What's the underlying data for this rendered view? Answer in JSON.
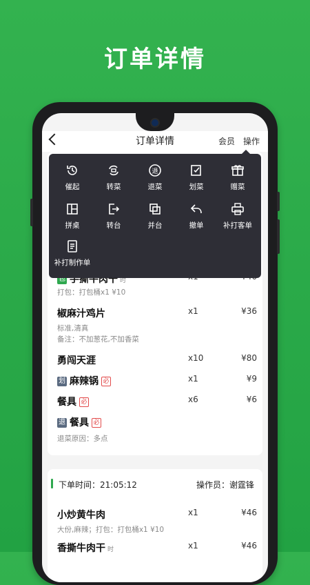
{
  "hero": {
    "title": "订单详情"
  },
  "navbar": {
    "title": "订单详情",
    "member": "会员",
    "ops": "操作"
  },
  "menu": {
    "items": [
      {
        "label": "催起",
        "icon": "clock-rewind-icon"
      },
      {
        "label": "转菜",
        "icon": "transfer-dish-icon"
      },
      {
        "label": "退菜",
        "icon": "return-dish-icon"
      },
      {
        "label": "划菜",
        "icon": "mark-dish-icon"
      },
      {
        "label": "赠菜",
        "icon": "gift-icon"
      },
      {
        "label": "拼桌",
        "icon": "merge-table-icon"
      },
      {
        "label": "转台",
        "icon": "switch-table-icon"
      },
      {
        "label": "并台",
        "icon": "combine-table-icon"
      },
      {
        "label": "撤单",
        "icon": "undo-icon"
      },
      {
        "label": "补打客单",
        "icon": "printer-icon"
      },
      {
        "label": "补打制作单",
        "icon": "document-icon"
      }
    ]
  },
  "order1": {
    "items": [
      {
        "tag": "包",
        "name": "手撕牛肉干",
        "note": "时",
        "qty": "x1",
        "price": "¥46",
        "sub": "打包：打包桶x1 ¥10"
      },
      {
        "name": "椒麻汁鸡片",
        "qty": "x1",
        "price": "¥36",
        "sub": "标准,清真",
        "sub2": "备注：不加葱花,不加香菜"
      },
      {
        "name": "勇闯天涯",
        "qty": "x10",
        "price": "¥80"
      },
      {
        "tag": "划",
        "name": "麻辣锅",
        "must": "必",
        "qty": "x1",
        "price": "¥9"
      },
      {
        "name": "餐具",
        "must": "必",
        "qty": "x6",
        "price": "¥6"
      },
      {
        "tag": "退",
        "name": "餐具",
        "must": "必",
        "sub": "退菜原因：多点"
      }
    ]
  },
  "order2": {
    "time": "下单时间：21:05:12",
    "operator": "操作员：谢霆锋",
    "items": [
      {
        "name": "小炒黄牛肉",
        "qty": "x1",
        "price": "¥46",
        "sub": "大份,麻辣；打包：打包桶x1 ¥10"
      },
      {
        "name": "香撕牛肉干",
        "note": "时",
        "qty": "x1",
        "price": "¥46"
      }
    ]
  },
  "colors": {
    "brand": "#2fa84f",
    "menu_bg": "#2e2e36",
    "must_red": "#e24a4a"
  }
}
